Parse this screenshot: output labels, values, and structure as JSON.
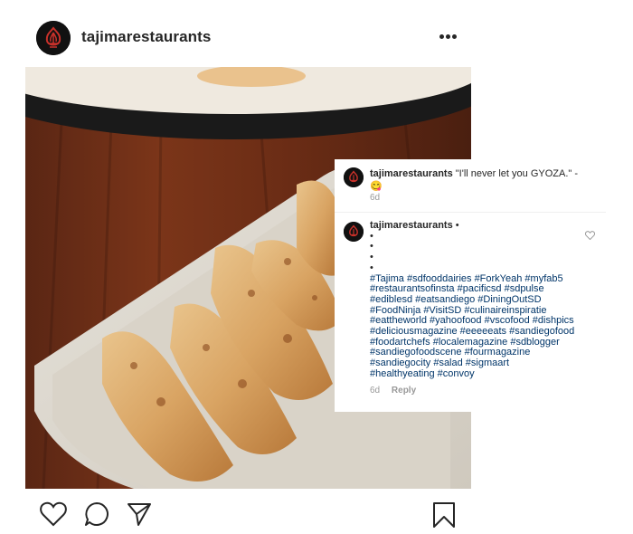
{
  "post": {
    "username": "tajimarestaurants",
    "more_icon": "more-horizontal-icon"
  },
  "caption": {
    "username": "tajimarestaurants",
    "text": "\"I'll never let you GYOZA.\" -",
    "emoji": "😋",
    "time": "6d"
  },
  "comment": {
    "username": "tajimarestaurants",
    "separator": "•",
    "bullets": [
      "•",
      "•",
      "•",
      "•"
    ],
    "hashtag_lines": [
      "#Tajima #sdfooddairies #ForkYeah #myfab5",
      "#restaurantsofinsta #pacificsd #sdpulse",
      "#ediblesd #eatsandiego #DiningOutSD",
      "#FoodNinja #VisitSD #culinaireinspiratie",
      "#eattheworld #yahoofood #vscofood #dishpics",
      "#deliciousmagazine #eeeeeats #sandiegofood",
      "#foodartchefs #localemagazine #sdblogger",
      "#sandiegofoodscene #fourmagazine",
      "#sandiegocity #salad #sigmaart",
      "#healthyeating #convoy"
    ],
    "time": "6d",
    "reply_label": "Reply"
  },
  "colors": {
    "text": "#262626",
    "hashtag": "#003569",
    "muted": "#999999",
    "avatar_bg": "#111111",
    "avatar_logo": "#c8312a"
  },
  "icons": [
    "like-heart-icon",
    "comment-bubble-icon",
    "share-send-icon",
    "bookmark-icon",
    "comment-like-heart-icon"
  ]
}
